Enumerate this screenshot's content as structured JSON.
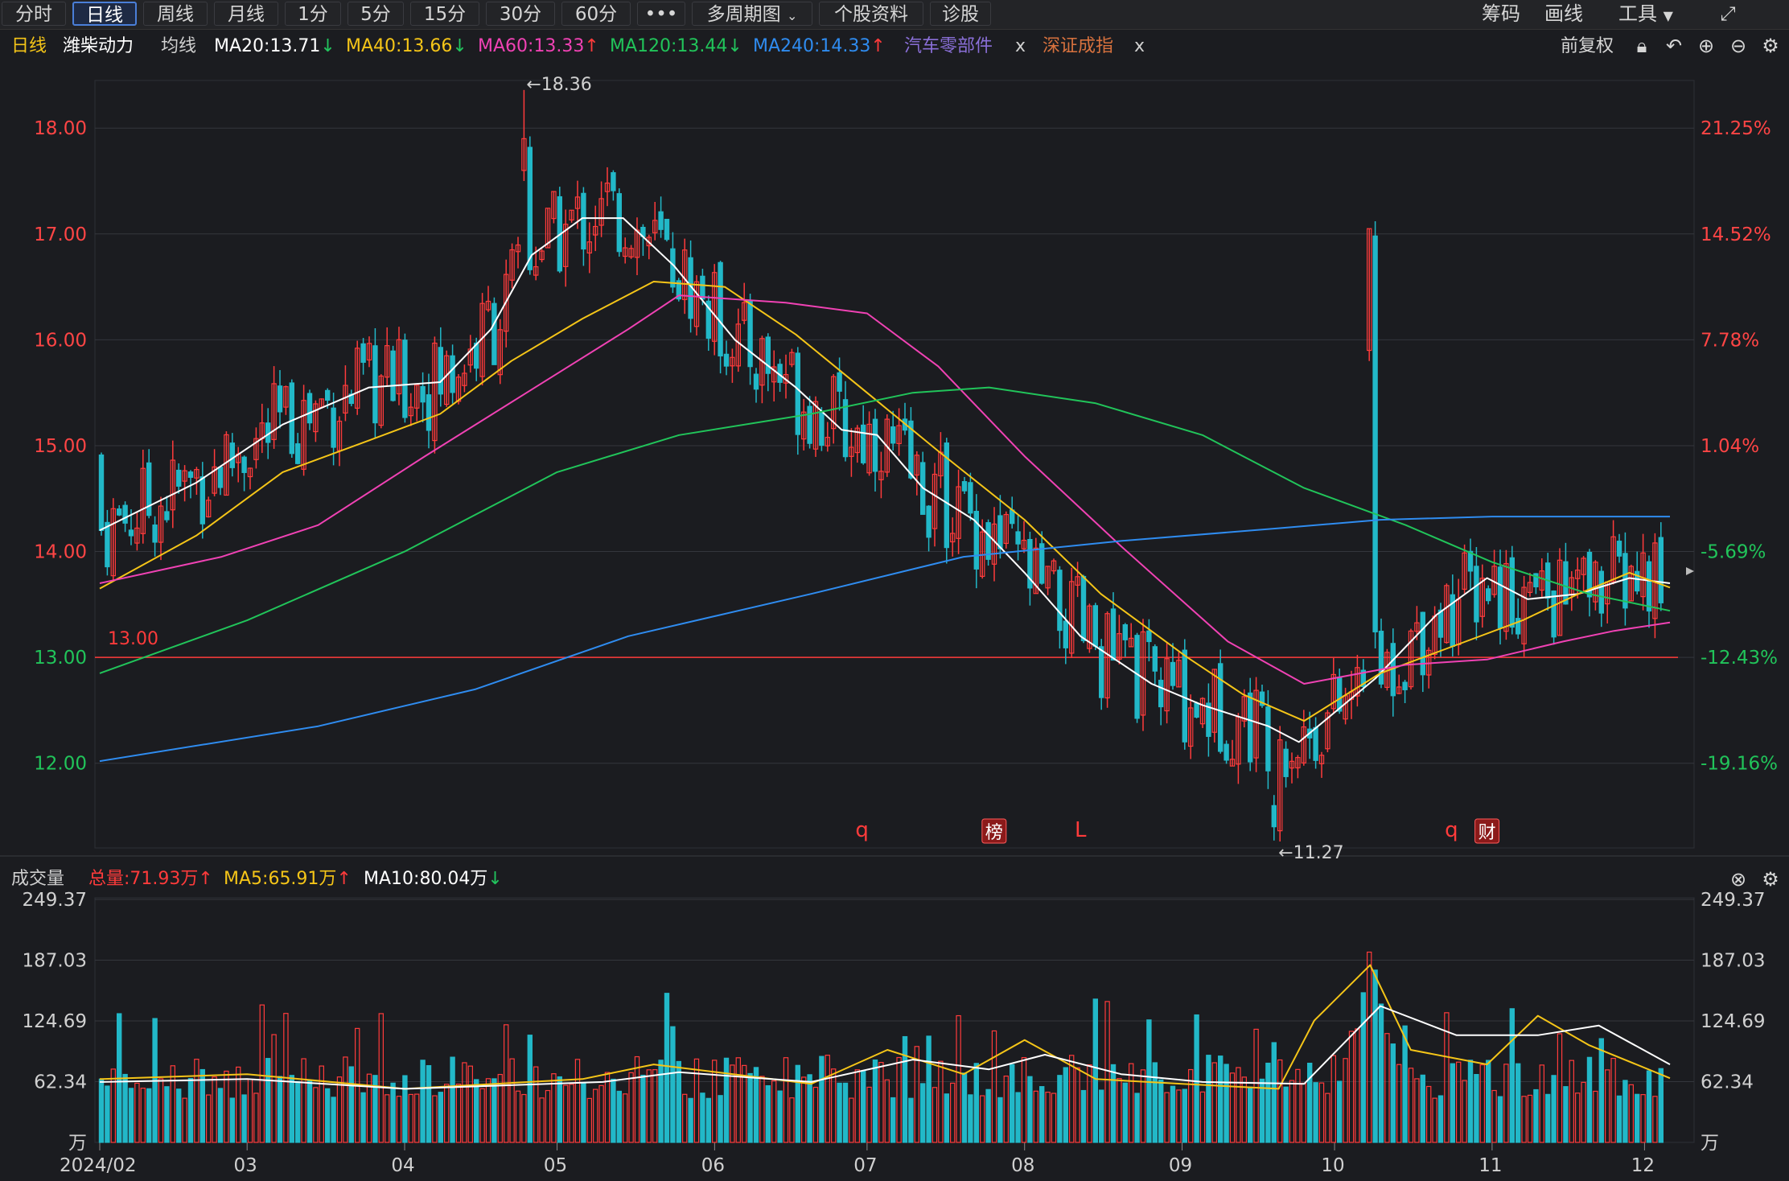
{
  "toolbar": {
    "tabs": [
      "分时",
      "日线",
      "周线",
      "月线",
      "1分",
      "5分",
      "15分",
      "30分",
      "60分",
      "•••",
      "多周期图",
      "个股资料",
      "诊股"
    ],
    "active_tab": "日线",
    "right_items": [
      "筹码",
      "画线",
      "工具"
    ]
  },
  "info": {
    "period": "日线",
    "stock_name": "潍柴动力",
    "ma_label": "均线",
    "ma20": "MA20:13.71",
    "ma40": "MA40:13.66",
    "ma60": "MA60:13.33",
    "ma120": "MA120:13.44",
    "ma240": "MA240:14.33",
    "sector": "汽车零部件",
    "index": "深证成指",
    "close_x": "x",
    "adjust": "前复权"
  },
  "volume_info": {
    "label": "成交量",
    "total": "总量:71.93万",
    "ma5": "MA5:65.91万",
    "ma10": "MA10:80.04万"
  },
  "colors": {
    "up": "#ff3b3b",
    "down": "#22b8c8",
    "ma20": "#ffffff",
    "ma40": "#f5c518",
    "ma60": "#f042b4",
    "ma120": "#21c45a",
    "ma240": "#2f8cf0",
    "sector": "#8a6fd8",
    "index": "#d8723e"
  },
  "markers": [
    {
      "label": "q",
      "date": "2024-06-30"
    },
    {
      "label": "榜",
      "date": "2024-07-26"
    },
    {
      "label": "L",
      "date": "2024-08-12"
    },
    {
      "label": "q",
      "date": "2024-10-24"
    },
    {
      "label": "财",
      "date": "2024-10-31"
    }
  ],
  "chart_data": [
    {
      "type": "candlestick",
      "title": "",
      "x_start": "2024-02-01",
      "x_end": "2024-12-06",
      "x_ticks": [
        "2024/02",
        "03",
        "04",
        "05",
        "06",
        "07",
        "08",
        "09",
        "10",
        "11",
        "12"
      ],
      "x_tick_dates": [
        "2024-02-01",
        "2024-03-01",
        "2024-04-01",
        "2024-05-01",
        "2024-06-01",
        "2024-07-01",
        "2024-08-01",
        "2024-09-01",
        "2024-10-01",
        "2024-11-01",
        "2024-12-01"
      ],
      "ylim": [
        11.2,
        18.45
      ],
      "y_ticks": [
        "12.00",
        "13.00",
        "14.00",
        "15.00",
        "16.00",
        "17.00",
        "18.00"
      ],
      "y_tick_values": [
        12,
        13,
        14,
        15,
        16,
        17,
        18
      ],
      "right_ticks": [
        "21.25%",
        "14.52%",
        "7.78%",
        "1.04%",
        "-5.69%",
        "-12.43%",
        "-19.16%"
      ],
      "grid": true,
      "annotations": [
        {
          "text": "←18.36",
          "date": "2024-04-24",
          "value": 18.36
        },
        {
          "text": "←11.27",
          "date": "2024-09-19",
          "value": 11.27
        }
      ],
      "reference_line": {
        "value": 13.0,
        "label": "13.00"
      },
      "series": [
        {
          "name": "MA20",
          "dates": [
            "2024-02-01",
            "2024-02-20",
            "2024-03-08",
            "2024-03-25",
            "2024-04-08",
            "2024-04-18",
            "2024-04-26",
            "2024-05-06",
            "2024-05-14",
            "2024-05-24",
            "2024-06-05",
            "2024-06-17",
            "2024-06-26",
            "2024-07-03",
            "2024-07-12",
            "2024-07-22",
            "2024-08-01",
            "2024-08-12",
            "2024-08-26",
            "2024-09-05",
            "2024-09-18",
            "2024-09-24",
            "2024-10-09",
            "2024-10-21",
            "2024-10-31",
            "2024-11-08",
            "2024-11-18",
            "2024-11-28",
            "2024-12-06"
          ],
          "values": [
            14.2,
            14.65,
            15.2,
            15.55,
            15.6,
            16.1,
            16.8,
            17.15,
            17.15,
            16.7,
            16.0,
            15.55,
            15.15,
            15.1,
            14.6,
            14.3,
            13.8,
            13.2,
            12.75,
            12.55,
            12.35,
            12.2,
            12.8,
            13.4,
            13.75,
            13.55,
            13.6,
            13.75,
            13.7
          ]
        },
        {
          "name": "MA40",
          "dates": [
            "2024-02-01",
            "2024-02-20",
            "2024-03-08",
            "2024-03-25",
            "2024-04-08",
            "2024-04-22",
            "2024-05-06",
            "2024-05-20",
            "2024-06-03",
            "2024-06-17",
            "2024-07-01",
            "2024-07-15",
            "2024-08-01",
            "2024-08-16",
            "2024-09-02",
            "2024-09-13",
            "2024-09-25",
            "2024-10-10",
            "2024-10-24",
            "2024-11-07",
            "2024-11-18",
            "2024-11-28",
            "2024-12-06"
          ],
          "values": [
            13.65,
            14.15,
            14.75,
            15.05,
            15.3,
            15.8,
            16.2,
            16.55,
            16.5,
            16.05,
            15.5,
            14.95,
            14.3,
            13.6,
            13.0,
            12.65,
            12.4,
            12.85,
            13.1,
            13.35,
            13.6,
            13.8,
            13.66
          ]
        },
        {
          "name": "MA60",
          "dates": [
            "2024-02-01",
            "2024-02-25",
            "2024-03-15",
            "2024-04-05",
            "2024-04-25",
            "2024-05-15",
            "2024-05-25",
            "2024-06-15",
            "2024-07-01",
            "2024-07-15",
            "2024-08-01",
            "2024-08-20",
            "2024-09-10",
            "2024-09-25",
            "2024-10-15",
            "2024-10-31",
            "2024-11-15",
            "2024-11-25",
            "2024-12-06"
          ],
          "values": [
            13.7,
            13.95,
            14.25,
            14.9,
            15.5,
            16.1,
            16.42,
            16.35,
            16.25,
            15.75,
            14.9,
            14.05,
            13.15,
            12.75,
            12.93,
            12.98,
            13.15,
            13.25,
            13.33
          ]
        },
        {
          "name": "MA120",
          "dates": [
            "2024-02-01",
            "2024-03-01",
            "2024-04-01",
            "2024-05-01",
            "2024-05-25",
            "2024-06-20",
            "2024-07-10",
            "2024-07-25",
            "2024-08-15",
            "2024-09-05",
            "2024-09-25",
            "2024-10-15",
            "2024-11-01",
            "2024-11-20",
            "2024-12-06"
          ],
          "values": [
            12.85,
            13.35,
            14.0,
            14.75,
            15.1,
            15.3,
            15.5,
            15.55,
            15.4,
            15.1,
            14.6,
            14.25,
            13.9,
            13.6,
            13.44
          ]
        },
        {
          "name": "MA240",
          "dates": [
            "2024-02-01",
            "2024-03-15",
            "2024-04-15",
            "2024-05-15",
            "2024-06-20",
            "2024-07-20",
            "2024-08-20",
            "2024-09-20",
            "2024-10-10",
            "2024-11-01",
            "2024-12-06"
          ],
          "values": [
            12.02,
            12.35,
            12.7,
            13.2,
            13.6,
            13.95,
            14.1,
            14.22,
            14.3,
            14.33,
            14.33
          ]
        }
      ]
    },
    {
      "type": "bar",
      "title": "",
      "ylim": [
        0,
        249.37
      ],
      "y_ticks": [
        "249.37",
        "187.03",
        "124.69",
        "62.34",
        "万"
      ],
      "y_tick_values": [
        249.37,
        187.03,
        124.69,
        62.34,
        0
      ],
      "grid": true,
      "series": [
        {
          "name": "MA5",
          "dates": [
            "2024-02-01",
            "2024-03-01",
            "2024-04-01",
            "2024-05-06",
            "2024-05-20",
            "2024-06-20",
            "2024-07-05",
            "2024-07-20",
            "2024-08-01",
            "2024-08-15",
            "2024-09-01",
            "2024-09-20",
            "2024-09-27",
            "2024-10-08",
            "2024-10-16",
            "2024-10-31",
            "2024-11-10",
            "2024-11-20",
            "2024-12-06"
          ],
          "values": [
            65,
            70,
            55,
            65,
            80,
            60,
            95,
            70,
            105,
            65,
            60,
            55,
            125,
            182,
            95,
            80,
            130,
            100,
            65.91
          ]
        },
        {
          "name": "MA10",
          "dates": [
            "2024-02-01",
            "2024-03-01",
            "2024-04-01",
            "2024-05-10",
            "2024-05-25",
            "2024-06-20",
            "2024-07-10",
            "2024-07-25",
            "2024-08-05",
            "2024-08-20",
            "2024-09-05",
            "2024-09-25",
            "2024-10-10",
            "2024-10-25",
            "2024-11-10",
            "2024-11-22",
            "2024-12-06"
          ],
          "values": [
            62,
            65,
            55,
            62,
            72,
            62,
            85,
            75,
            90,
            70,
            62,
            60,
            140,
            110,
            110,
            120,
            80.04
          ]
        }
      ]
    }
  ]
}
